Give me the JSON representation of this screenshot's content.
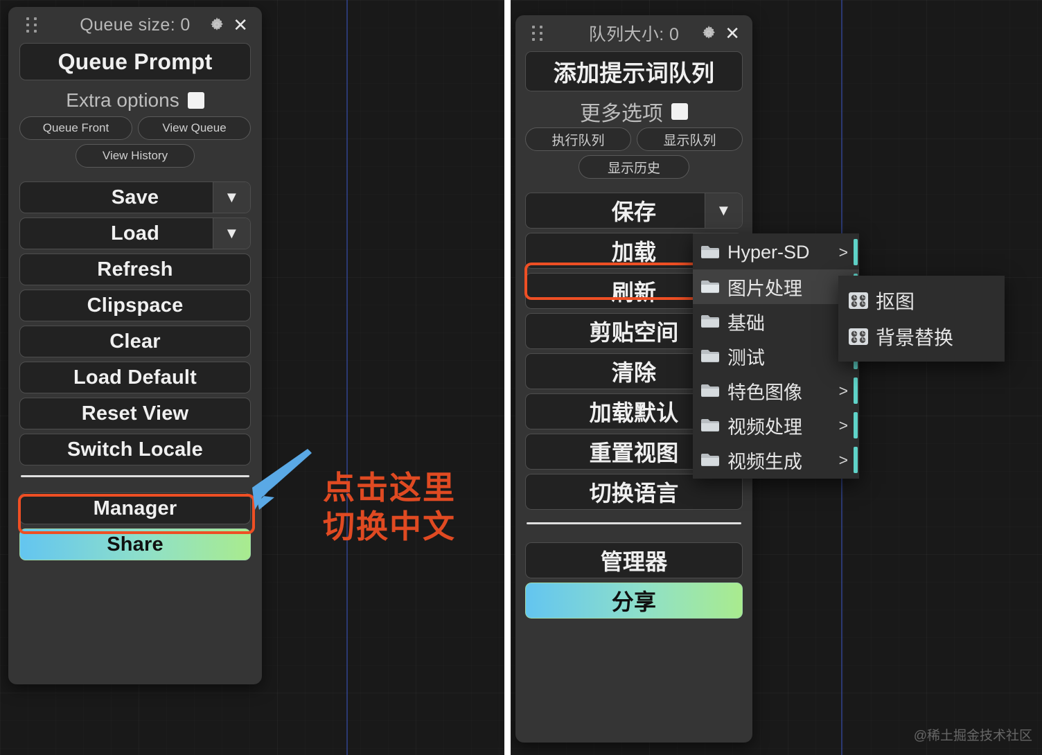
{
  "split": {
    "divider_color": "#ffffff"
  },
  "colors": {
    "panel_bg": "#353535",
    "button_bg": "#222222",
    "accent_highlight": "#ee4f24",
    "annotation_text": "#e04a22",
    "arrow": "#5aa9e6",
    "menu_bar_cyan": "#5fd3c8",
    "share_gradient_start": "#63c5f0",
    "share_gradient_end": "#a9eb8e"
  },
  "panel_en": {
    "queue_size_label": "Queue size: 0",
    "gear_icon": "gear-icon",
    "close_icon": "close-icon",
    "drag_icon": "drag-handle-icon",
    "queue_prompt_label": "Queue Prompt",
    "extra_options_label": "Extra options",
    "extra_options_checked": false,
    "mini_buttons": [
      "Queue Front",
      "View Queue",
      "View History"
    ],
    "buttons": [
      {
        "label": "Save",
        "caret": true
      },
      {
        "label": "Load",
        "caret": true
      },
      {
        "label": "Refresh",
        "caret": false
      },
      {
        "label": "Clipspace",
        "caret": false
      },
      {
        "label": "Clear",
        "caret": false
      },
      {
        "label": "Load Default",
        "caret": false
      },
      {
        "label": "Reset View",
        "caret": false
      },
      {
        "label": "Switch Locale",
        "caret": false
      }
    ],
    "manager_label": "Manager",
    "share_label": "Share"
  },
  "panel_zh": {
    "queue_size_label": "队列大小: 0",
    "gear_icon": "gear-icon",
    "close_icon": "close-icon",
    "drag_icon": "drag-handle-icon",
    "queue_prompt_label": "添加提示词队列",
    "extra_options_label": "更多选项",
    "extra_options_checked": false,
    "mini_buttons": [
      "执行队列",
      "显示队列",
      "显示历史"
    ],
    "buttons": [
      {
        "label": "保存",
        "caret": true
      },
      {
        "label": "加载",
        "caret": true
      },
      {
        "label": "刷新",
        "caret": false
      },
      {
        "label": "剪贴空间",
        "caret": false
      },
      {
        "label": "清除",
        "caret": false
      },
      {
        "label": "加载默认",
        "caret": false
      },
      {
        "label": "重置视图",
        "caret": false
      },
      {
        "label": "切换语言",
        "caret": false
      }
    ],
    "manager_label": "管理器",
    "share_label": "分享"
  },
  "context_menu": {
    "items": [
      {
        "label": "Hyper-SD",
        "arrow": ">",
        "icon": "folder-icon",
        "active": false
      },
      {
        "label": "图片处理",
        "arrow": ">",
        "icon": "folder-icon",
        "active": true
      },
      {
        "label": "基础",
        "arrow": ">",
        "icon": "folder-icon",
        "active": false
      },
      {
        "label": "测试",
        "arrow": ">",
        "icon": "folder-icon",
        "active": false
      },
      {
        "label": "特色图像",
        "arrow": ">",
        "icon": "folder-icon",
        "active": false
      },
      {
        "label": "视频处理",
        "arrow": ">",
        "icon": "folder-icon",
        "active": false
      },
      {
        "label": "视频生成",
        "arrow": ">",
        "icon": "folder-icon",
        "active": false
      }
    ],
    "submenu": [
      {
        "label": "抠图",
        "icon": "dice-icon"
      },
      {
        "label": "背景替换",
        "icon": "dice-icon"
      }
    ]
  },
  "annotation": {
    "line1": "点击这里",
    "line2": "切换中文",
    "arrow_icon": "arrow-pointer-icon"
  },
  "watermark": {
    "text": "@稀土掘金技术社区"
  }
}
